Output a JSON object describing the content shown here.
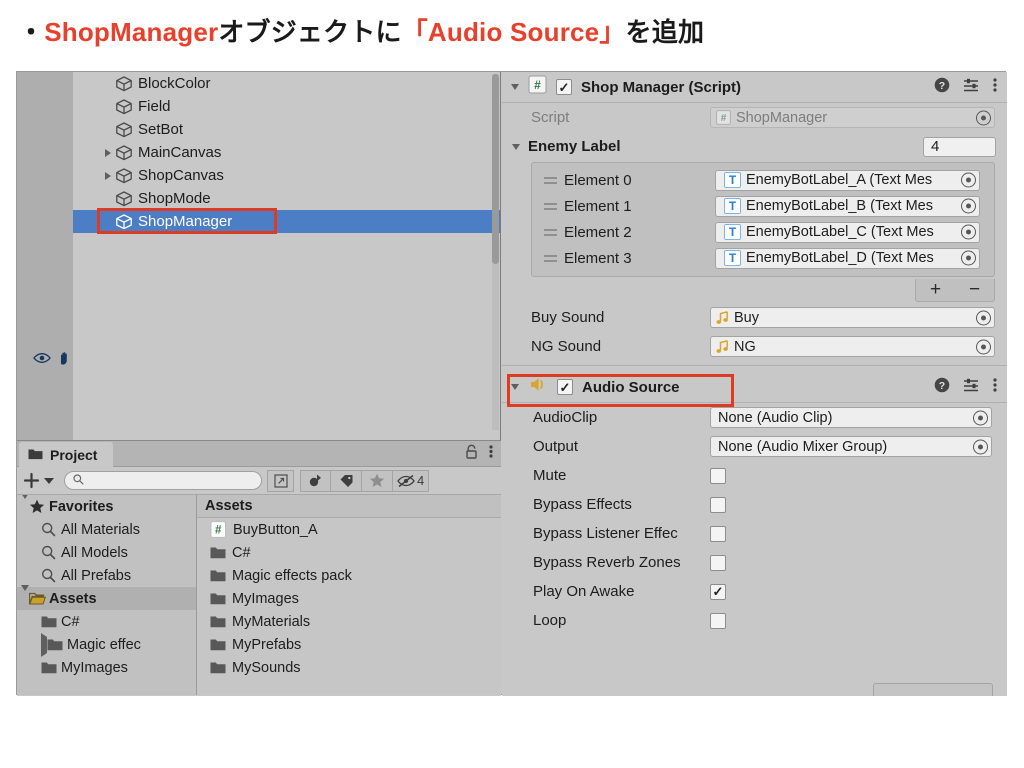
{
  "slide": {
    "bullet": "・",
    "title_part1": "ShopManager",
    "title_part2": "オブジェクトに",
    "title_part3": "「Audio Source」",
    "title_part4": "を追加",
    "accent_color": "#e8402a"
  },
  "hierarchy": {
    "items": [
      {
        "label": "BlockColor",
        "indent": 2,
        "expandable": false,
        "selected": false
      },
      {
        "label": "Field",
        "indent": 2,
        "expandable": false,
        "selected": false
      },
      {
        "label": "SetBot",
        "indent": 2,
        "expandable": false,
        "selected": false
      },
      {
        "label": "MainCanvas",
        "indent": 2,
        "expandable": true,
        "selected": false
      },
      {
        "label": "ShopCanvas",
        "indent": 2,
        "expandable": true,
        "selected": false
      },
      {
        "label": "ShopMode",
        "indent": 2,
        "expandable": false,
        "selected": false
      },
      {
        "label": "ShopManager",
        "indent": 2,
        "expandable": false,
        "selected": true
      }
    ],
    "selection_color": "#4b7ec4",
    "highlight_color": "#dd3c22"
  },
  "project": {
    "tab_label": "Project",
    "lock_icon": "lock-icon",
    "menu_icon": "kebab-menu-icon",
    "search_value": "",
    "search_placeholder": "",
    "hidden_count": "4",
    "tree": [
      {
        "label": "Favorites",
        "type": "section",
        "icon": "star-icon",
        "expanded": true
      },
      {
        "label": "All Materials",
        "type": "search",
        "icon": "search-icon"
      },
      {
        "label": "All Models",
        "type": "search",
        "icon": "search-icon"
      },
      {
        "label": "All Prefabs",
        "type": "search",
        "icon": "search-icon"
      },
      {
        "label": "Assets",
        "type": "section",
        "icon": "folder-open-icon",
        "expanded": true
      },
      {
        "label": "C#",
        "type": "folder",
        "icon": "folder-icon",
        "expandable": false
      },
      {
        "label": "Magic effec",
        "type": "folder",
        "icon": "folder-icon",
        "expandable": true
      },
      {
        "label": "MyImages",
        "type": "folder",
        "icon": "folder-icon",
        "expandable": false
      }
    ],
    "assets_header": "Assets",
    "assets": [
      {
        "label": "BuyButton_A",
        "icon": "csharp-script-icon"
      },
      {
        "label": "C#",
        "icon": "folder-icon"
      },
      {
        "label": "Magic effects pack",
        "icon": "folder-icon"
      },
      {
        "label": "MyImages",
        "icon": "folder-icon"
      },
      {
        "label": "MyMaterials",
        "icon": "folder-icon"
      },
      {
        "label": "MyPrefabs",
        "icon": "folder-icon"
      },
      {
        "label": "MySounds",
        "icon": "folder-icon"
      }
    ]
  },
  "inspector": {
    "shop_manager": {
      "title": "Shop Manager (Script)",
      "icon": "csharp-script-icon",
      "enabled": true,
      "check_glyph": "✓",
      "script_label": "Script",
      "script_value": "ShopManager",
      "enemy_label_title": "Enemy Label",
      "array_size": "4",
      "elements": [
        {
          "name": "Element 0",
          "value": "EnemyBotLabel_A (Text Mes",
          "icon": "textmeshpro-icon"
        },
        {
          "name": "Element 1",
          "value": "EnemyBotLabel_B (Text Mes",
          "icon": "textmeshpro-icon"
        },
        {
          "name": "Element 2",
          "value": "EnemyBotLabel_C (Text Mes",
          "icon": "textmeshpro-icon"
        },
        {
          "name": "Element 3",
          "value": "EnemyBotLabel_D (Text Mes",
          "icon": "textmeshpro-icon"
        }
      ],
      "add_label": "+",
      "remove_label": "−",
      "sounds": [
        {
          "label": "Buy Sound",
          "value": "Buy",
          "icon": "audio-clip-icon"
        },
        {
          "label": "NG Sound",
          "value": "NG",
          "icon": "audio-clip-icon"
        }
      ]
    },
    "audio_source": {
      "title": "Audio Source",
      "icon": "speaker-icon",
      "enabled": true,
      "check_glyph": "✓",
      "highlighted": true,
      "object_fields": [
        {
          "label": "AudioClip",
          "value": "None (Audio Clip)"
        },
        {
          "label": "Output",
          "value": "None (Audio Mixer Group)"
        }
      ],
      "toggles": [
        {
          "label": "Mute",
          "checked": false
        },
        {
          "label": "Bypass Effects",
          "checked": false
        },
        {
          "label": "Bypass Listener Effec",
          "checked": false
        },
        {
          "label": "Bypass Reverb Zones",
          "checked": false
        },
        {
          "label": "Play On Awake",
          "checked": true
        },
        {
          "label": "Loop",
          "checked": false
        }
      ]
    },
    "header_icons": {
      "help": "help-icon",
      "preset": "preset-settings-icon",
      "menu": "kebab-menu-icon"
    }
  }
}
